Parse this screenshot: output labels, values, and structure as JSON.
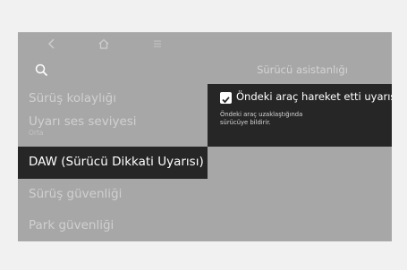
{
  "header": {
    "back_icon": "chevron-left-icon",
    "home_icon": "home-icon",
    "menu_icon": "menu-icon",
    "search_icon": "search-icon",
    "title": "Sürücü asistanlığı"
  },
  "sidebar": {
    "items": [
      {
        "label": "Sürüş kolaylığı"
      },
      {
        "label": "Uyarı ses seviyesi",
        "sub": "Orta"
      },
      {
        "label": "DAW (Sürücü Dikkati Uyarısı)",
        "active": true
      },
      {
        "label": "Sürüş güvenliği"
      },
      {
        "label": "Park güvenliği"
      }
    ]
  },
  "detail": {
    "option_label": "Öndeki araç hareket etti uyarısı",
    "checked": true,
    "description_line1": "Öndeki araç uzaklaştığında",
    "description_line2": "sürücüye bildirir."
  },
  "colors": {
    "screen_bg": "#a7a7a7",
    "active_bg": "#262626",
    "page_bg": "#f1f1f1"
  }
}
